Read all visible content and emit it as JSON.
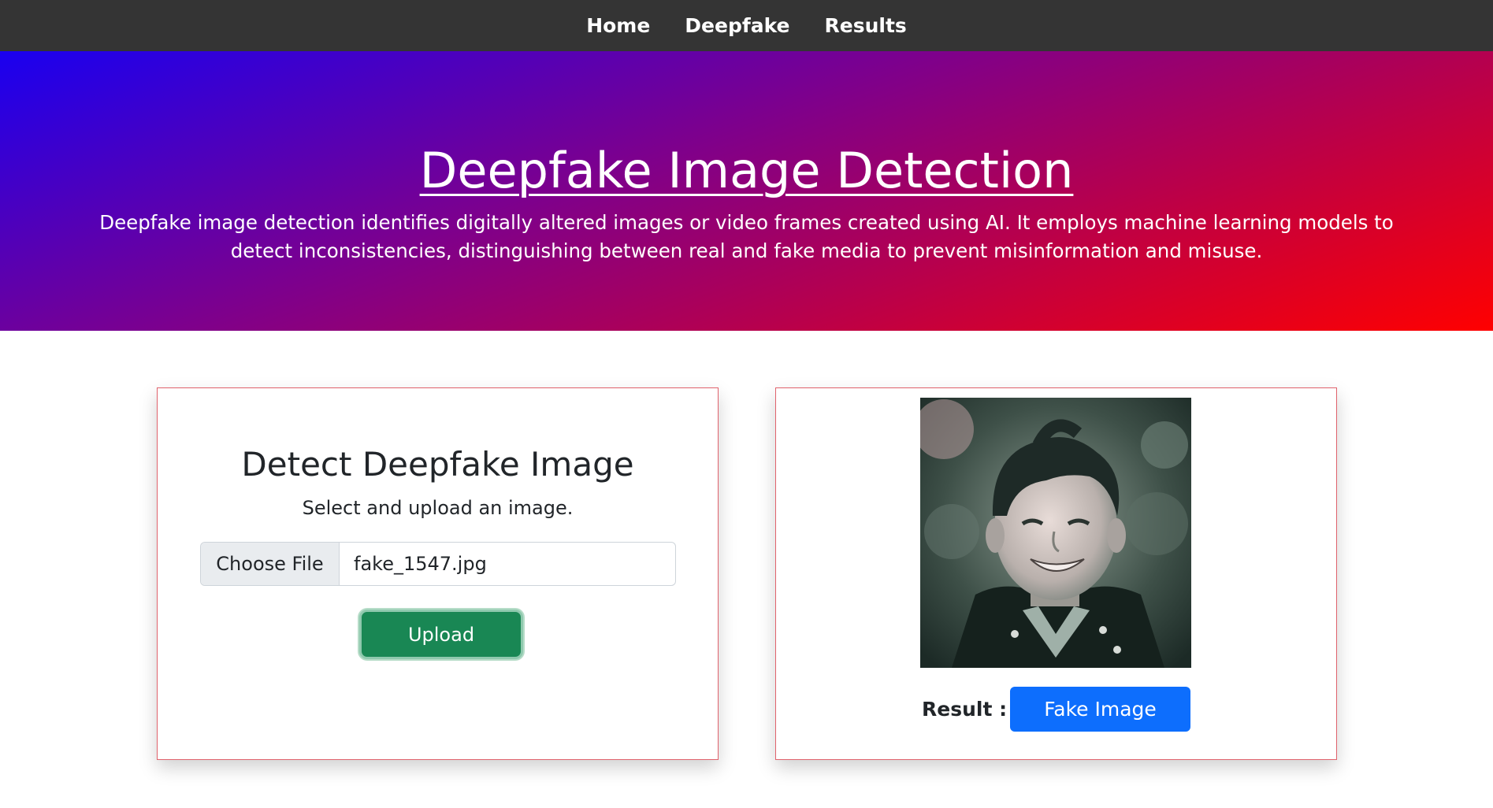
{
  "nav": {
    "items": [
      {
        "label": "Home"
      },
      {
        "label": "Deepfake"
      },
      {
        "label": "Results"
      }
    ]
  },
  "hero": {
    "title": "Deepfake Image Detection",
    "description": "Deepfake image detection identifies digitally altered images or video frames created using AI. It employs machine learning models to detect inconsistencies, distinguishing between real and fake media to prevent misinformation and misuse.",
    "gradient_colors": [
      "#1a00f0",
      "#7a0090",
      "#c8003a",
      "#ff0000"
    ]
  },
  "upload_card": {
    "title": "Detect Deepfake Image",
    "subtitle": "Select and upload an image.",
    "file_button_label": "Choose File",
    "file_name": "fake_1547.jpg",
    "upload_label": "Upload",
    "upload_color": "#198754"
  },
  "result_card": {
    "image_alt": "uploaded face image",
    "result_label": "Result :",
    "result_value": "Fake Image",
    "result_color": "#0d6efd"
  }
}
